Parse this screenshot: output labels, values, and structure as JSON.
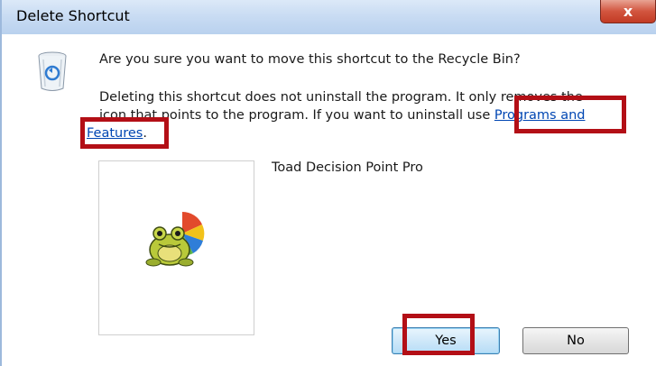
{
  "window": {
    "title": "Delete Shortcut",
    "close_glyph": "x"
  },
  "dialog": {
    "question": "Are you sure you want to move this shortcut to the Recycle Bin?",
    "desc_line1": "Deleting this shortcut does not uninstall the program. It only removes the",
    "desc_line2_text": "icon that points to the program. If you want to uninstall use ",
    "link_part1": "Programs and",
    "link_part2": "Features",
    "desc_line3_suffix": "."
  },
  "program": {
    "name": "Toad Decision Point Pro"
  },
  "buttons": {
    "yes_label": "Yes",
    "no_label": "No"
  },
  "icons": {
    "dialog_icon": "recycle-bin-icon",
    "program_icon": "toad-frog-icon"
  },
  "colors": {
    "link": "#0046b3",
    "highlight": "#b30f16",
    "titlebar": "#c9dcf3",
    "close_button": "#d2553f"
  }
}
